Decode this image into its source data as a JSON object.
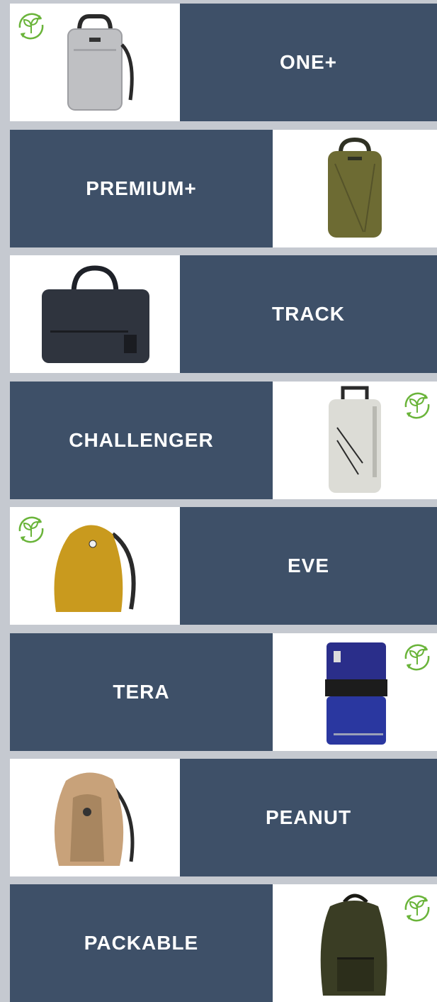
{
  "colors": {
    "background": "#c5c9d0",
    "label_panel": "#3e5068",
    "label_text": "#ffffff",
    "eco_badge": "#6ab43a"
  },
  "products": [
    {
      "name": "ONE+",
      "image_side": "left",
      "eco": true,
      "image": "light-grey-laptop-backpack"
    },
    {
      "name": "PREMIUM+",
      "image_side": "right",
      "eco": false,
      "image": "olive-green-backpack"
    },
    {
      "name": "TRACK",
      "image_side": "left",
      "eco": false,
      "image": "dark-navy-laptop-briefcase"
    },
    {
      "name": "CHALLENGER",
      "image_side": "right",
      "eco": true,
      "image": "off-white-trolley-backpack"
    },
    {
      "name": "EVE",
      "image_side": "left",
      "eco": true,
      "image": "mustard-yellow-rounded-backpack"
    },
    {
      "name": "TERA",
      "image_side": "right",
      "eco": true,
      "image": "blue-black-rolltop-backpack"
    },
    {
      "name": "PEANUT",
      "image_side": "left",
      "eco": false,
      "image": "tan-patterned-backpack"
    },
    {
      "name": "PACKABLE",
      "image_side": "right",
      "eco": true,
      "image": "dark-olive-packable-backpack"
    }
  ]
}
